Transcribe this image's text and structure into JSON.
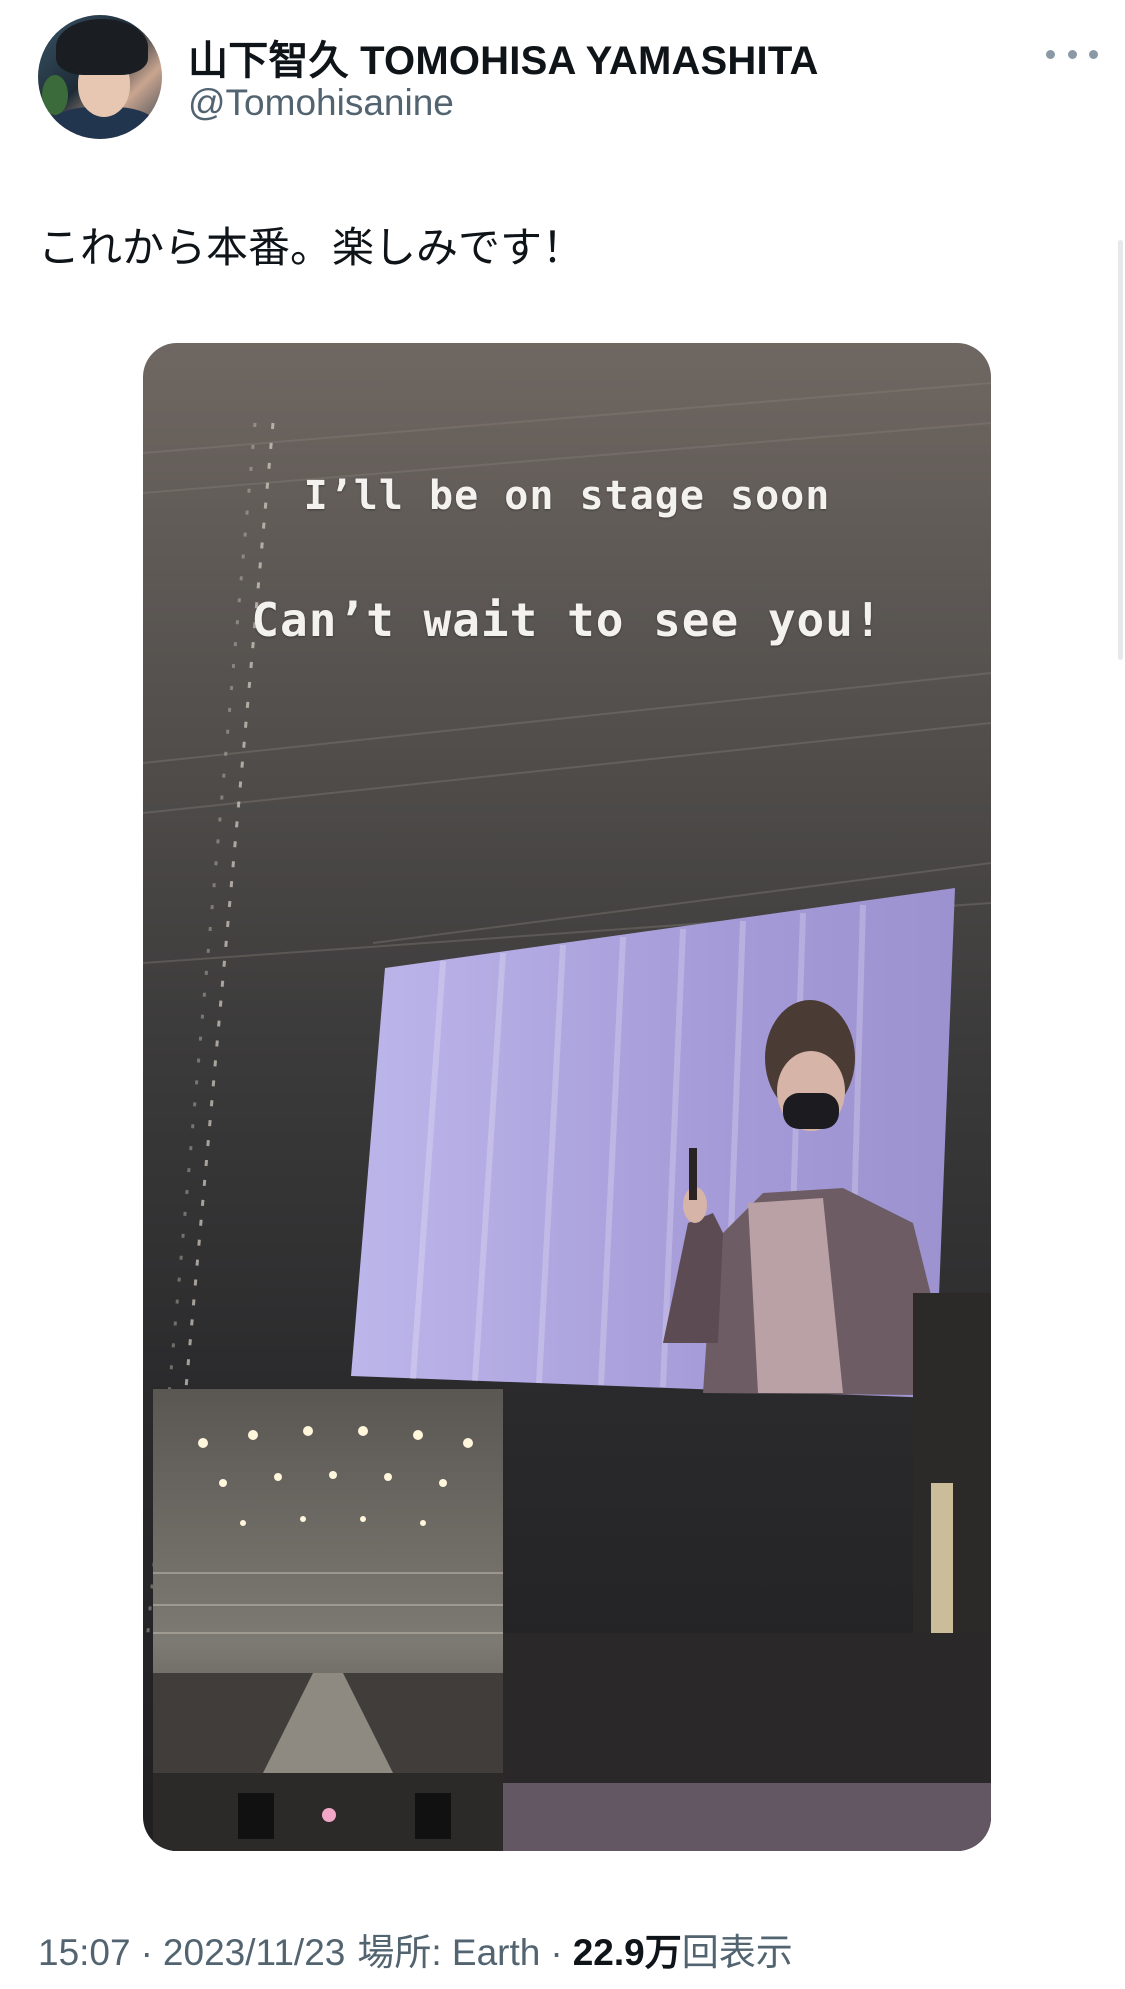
{
  "tweet": {
    "author": {
      "display_name": "山下智久 TOMOHISA YAMASHITA",
      "handle": "@Tomohisanine"
    },
    "text": "これから本番。楽しみです！",
    "media": {
      "story_line1": "I’ll be on stage soon",
      "story_line2": "Can’t wait to see you!"
    },
    "meta": {
      "time": "15:07",
      "separator": "·",
      "date": "2023/11/23",
      "location": "場所: Earth",
      "views_count": "22.9万",
      "views_label": "回表示"
    }
  },
  "icons": {
    "more": "more-horizontal-icon"
  },
  "colors": {
    "text_primary": "#0f1419",
    "text_secondary": "#536471",
    "background": "#ffffff"
  }
}
